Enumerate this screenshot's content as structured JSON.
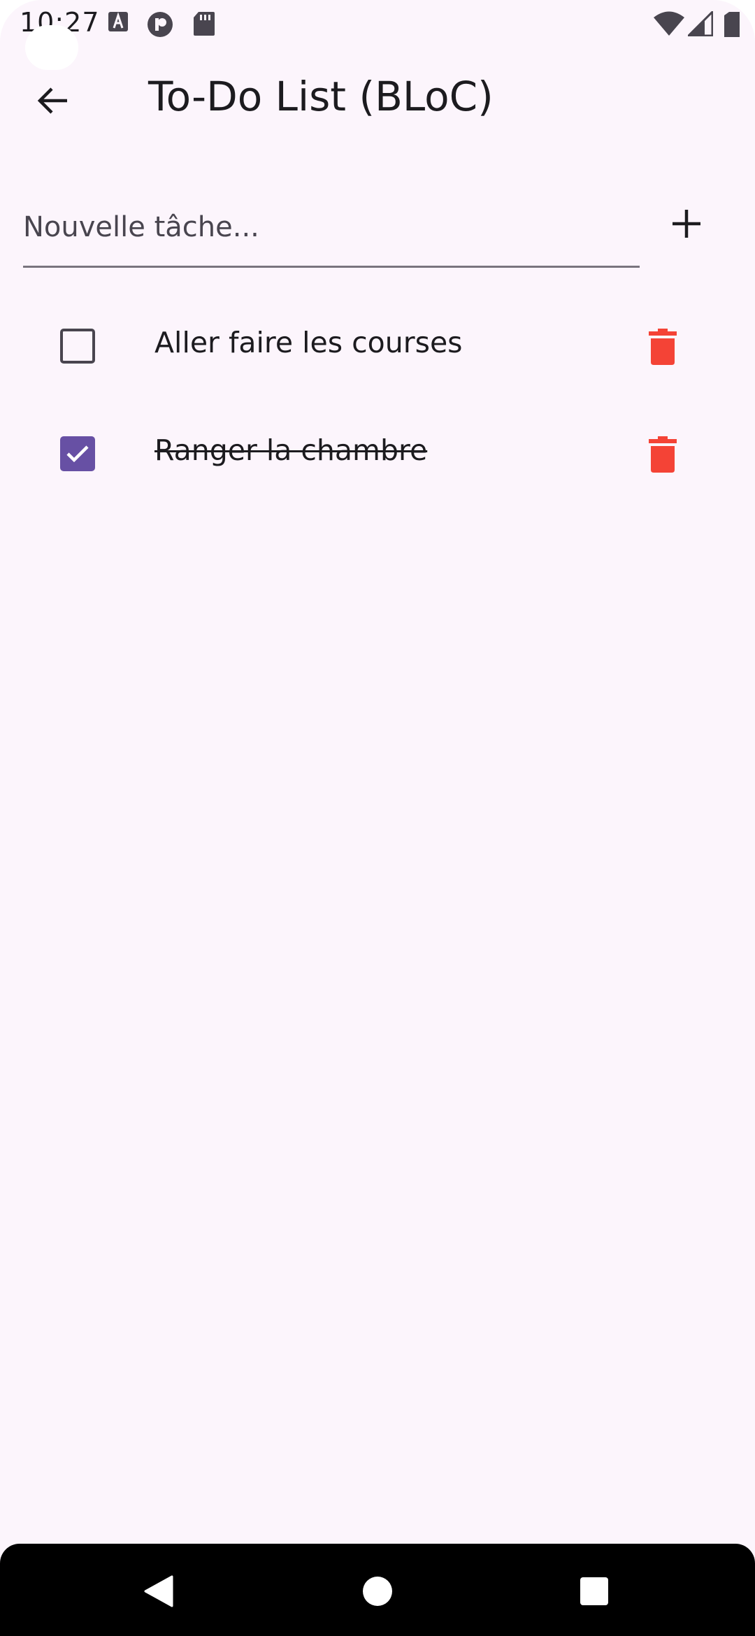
{
  "status_bar": {
    "time": "10:27",
    "icons": [
      "a-icon",
      "pinterest-icon",
      "sd-card-icon",
      "wifi-icon",
      "signal-icon",
      "battery-icon"
    ]
  },
  "app_bar": {
    "title": "To-Do List (BLoC)",
    "back_icon": "arrow-back-icon"
  },
  "new_task": {
    "placeholder": "Nouvelle tâche...",
    "value": "",
    "add_icon": "plus-icon"
  },
  "todos": [
    {
      "label": "Aller faire les courses",
      "done": false
    },
    {
      "label": "Ranger la chambre",
      "done": true
    }
  ],
  "colors": {
    "background": "#fcf5fc",
    "accent": "#6750a4",
    "delete": "#f44336",
    "text": "#1c1b1f"
  },
  "nav_bar": {
    "buttons": [
      "back-triangle-icon",
      "home-circle-icon",
      "recents-square-icon"
    ]
  }
}
